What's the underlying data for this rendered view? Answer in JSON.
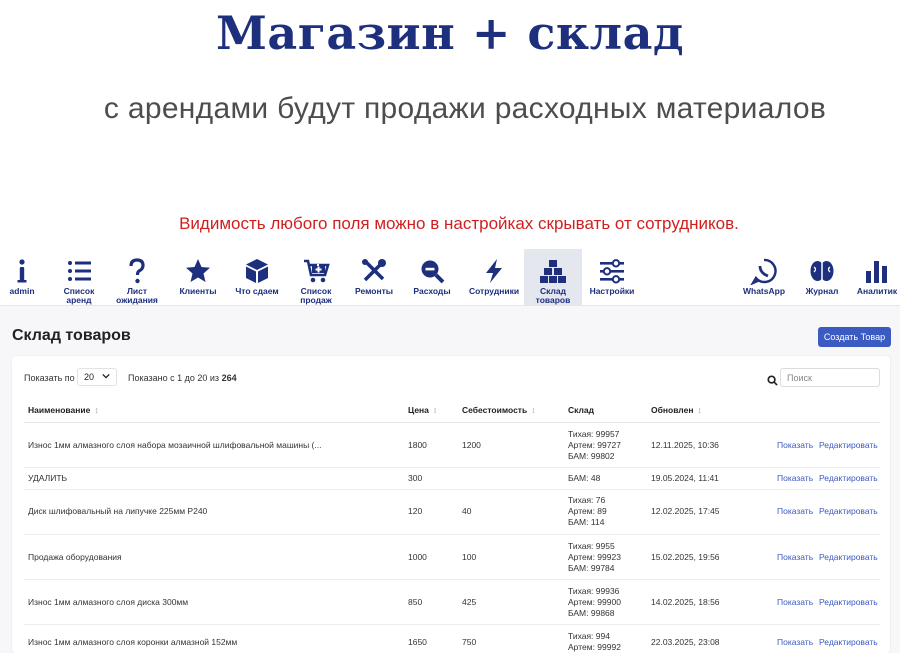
{
  "hero": {
    "title": "Магазин + склад",
    "subtitle": "с арендами будут продажи расходных материалов"
  },
  "notice": "Видимость любого поля можно в настройках скрывать от сотрудников.",
  "nav": {
    "items": [
      {
        "label": "admin",
        "icon": "info-icon"
      },
      {
        "label": "Список\nаренд",
        "icon": "list-icon"
      },
      {
        "label": "Лист\nожидания",
        "icon": "question-icon"
      },
      {
        "label": "Клиенты",
        "icon": "star-icon"
      },
      {
        "label": "Что сдаем",
        "icon": "box-icon"
      },
      {
        "label": "Список\nпродаж",
        "icon": "cart-icon"
      },
      {
        "label": "Ремонты",
        "icon": "tools-icon"
      },
      {
        "label": "Расходы",
        "icon": "zoom-out-icon"
      },
      {
        "label": "Сотрудники",
        "icon": "bolt-icon"
      },
      {
        "label": "Склад\nтоваров",
        "icon": "boxes-icon"
      },
      {
        "label": "Настройки",
        "icon": "sliders-icon"
      },
      {
        "label": "WhatsApp",
        "icon": "whatsapp-icon"
      },
      {
        "label": "Журнал",
        "icon": "brain-icon"
      },
      {
        "label": "Аналитик",
        "icon": "bar-chart-icon"
      }
    ],
    "active_index": 9,
    "color": "#1d2f7d"
  },
  "page": {
    "title": "Склад товаров",
    "create_button": "Создать Товар"
  },
  "table_controls": {
    "show_label": "Показать по",
    "per_page": "20",
    "showing_prefix": "Показано с 1 до 20 из",
    "total": "264",
    "search_placeholder": "Поиск"
  },
  "table": {
    "columns": [
      "Наименование",
      "Цена",
      "Себестоимость",
      "Склад",
      "Обновлен"
    ],
    "actions": {
      "show": "Показать",
      "edit": "Редактировать"
    },
    "rows": [
      {
        "name": "Износ 1мм алмазного слоя набора мозаичной шлифовальной машины (...",
        "price": "1800",
        "cost": "1200",
        "stock": [
          "Тихая: 99957",
          "Артем: 99727",
          "БАМ: 99802"
        ],
        "updated": "12.11.2025, 10:36"
      },
      {
        "name": "УДАЛИТЬ",
        "price": "300",
        "cost": "",
        "stock": [
          "БАМ: 48"
        ],
        "updated": "19.05.2024, 11:41"
      },
      {
        "name": "Диск шлифовальный на липучке 225мм P240",
        "price": "120",
        "cost": "40",
        "stock": [
          "Тихая: 76",
          "Артем: 89",
          "БАМ: 114"
        ],
        "updated": "12.02.2025, 17:45"
      },
      {
        "name": "Продажа оборудования",
        "price": "1000",
        "cost": "100",
        "stock": [
          "Тихая: 9955",
          "Артем: 99923",
          "БАМ: 99784"
        ],
        "updated": "15.02.2025, 19:56"
      },
      {
        "name": "Износ 1мм алмазного слоя диска 300мм",
        "price": "850",
        "cost": "425",
        "stock": [
          "Тихая: 99936",
          "Артем: 99900",
          "БАМ: 99868"
        ],
        "updated": "14.02.2025, 18:56"
      },
      {
        "name": "Износ 1мм алмазного слоя коронки алмазной 152мм",
        "price": "1650",
        "cost": "750",
        "stock": [
          "Тихая: 994",
          "Артем: 99992"
        ],
        "updated": "22.03.2025, 23:08"
      }
    ]
  },
  "colors": {
    "title": "#1d2f7d",
    "notice": "#d01f1f",
    "accent": "#3b5bc2"
  }
}
